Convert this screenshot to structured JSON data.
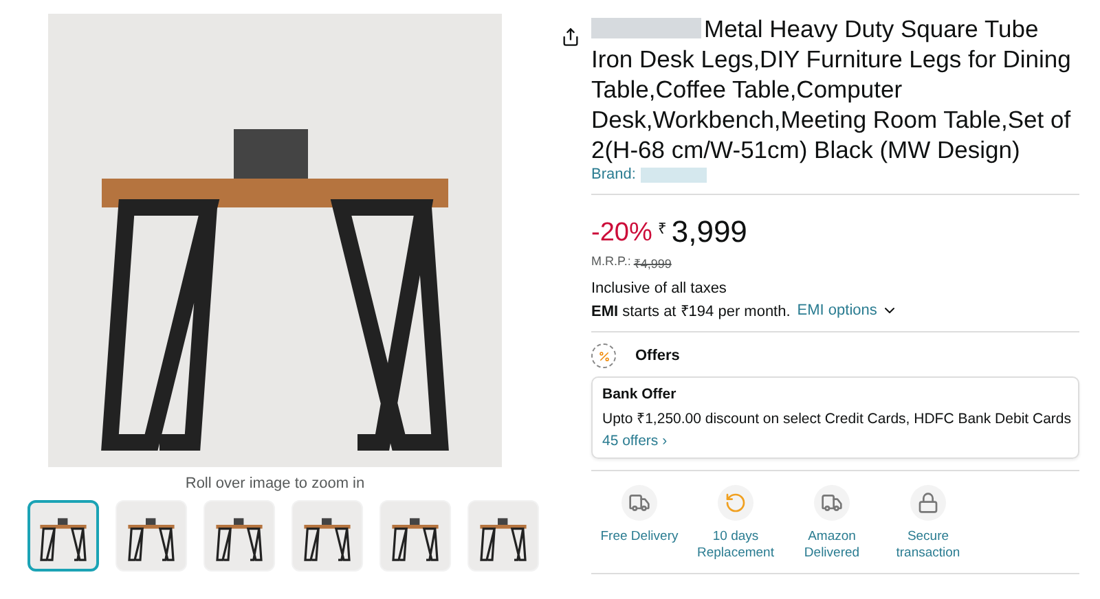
{
  "gallery": {
    "hint": "Roll over image to zoom in",
    "thumbnails": [
      {
        "selected": true
      },
      {
        "selected": false
      },
      {
        "selected": false
      },
      {
        "selected": false
      },
      {
        "selected": false
      },
      {
        "selected": false
      }
    ]
  },
  "product": {
    "title": "Metal Heavy Duty Square Tube Iron Desk Legs,DIY Furniture Legs for Dining Table,Coffee Table,Computer Desk,Workbench,Meeting Room Table,Set of 2(H-68 cm/W-51cm) Black (MW Design)",
    "brand_label": "Brand:"
  },
  "price": {
    "discount": "-20%",
    "currency": "₹",
    "amount": "3,999",
    "mrp_label": "M.R.P.:",
    "mrp": "₹4,999",
    "tax_note": "Inclusive of all taxes",
    "emi": "**EMI** starts at ₹194 per month.",
    "emi_link": "EMI options"
  },
  "offers": {
    "heading": "Offers",
    "cards": [
      {
        "title": "Bank Offer",
        "text": "Upto ₹1,250.00 discount on select Credit Cards, HDFC Bank Debit Cards",
        "link": "45 offers ›"
      }
    ]
  },
  "features": [
    {
      "kind": "delivery",
      "label": "Free Delivery"
    },
    {
      "kind": "replacement",
      "label": "10 days Replacement"
    },
    {
      "kind": "delivered",
      "label": "Amazon Delivered"
    },
    {
      "kind": "secure",
      "label": "Secure transaction"
    }
  ]
}
